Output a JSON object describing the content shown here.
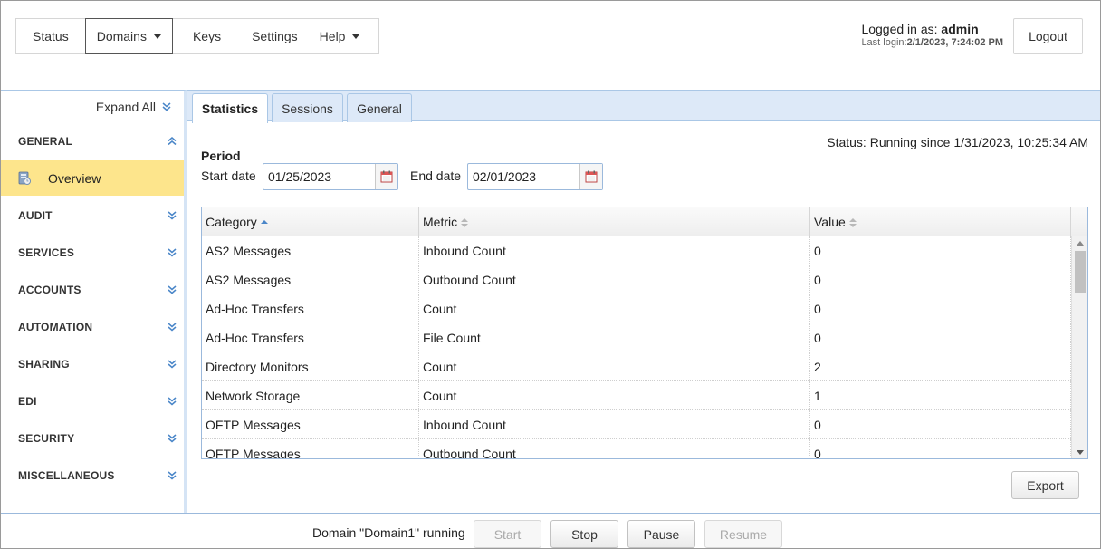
{
  "nav": {
    "items": [
      {
        "label": "Status"
      },
      {
        "label": "Domains"
      },
      {
        "label": "Keys"
      },
      {
        "label": "Settings"
      },
      {
        "label": "Help"
      }
    ]
  },
  "user": {
    "logged_in_prefix": "Logged in as:",
    "username": "admin",
    "last_login_prefix": "Last login:",
    "last_login": "2/1/2023, 7:24:02 PM",
    "logout_label": "Logout"
  },
  "sidebar": {
    "expand_all_label": "Expand All",
    "sections": [
      {
        "label": "GENERAL",
        "expanded": true
      },
      {
        "label": "AUDIT"
      },
      {
        "label": "SERVICES"
      },
      {
        "label": "ACCOUNTS"
      },
      {
        "label": "AUTOMATION"
      },
      {
        "label": "SHARING"
      },
      {
        "label": "EDI"
      },
      {
        "label": "SECURITY"
      },
      {
        "label": "MISCELLANEOUS"
      }
    ],
    "selected_item": {
      "label": "Overview",
      "icon": "overview-icon"
    }
  },
  "tabs": [
    {
      "label": "Statistics",
      "active": true
    },
    {
      "label": "Sessions"
    },
    {
      "label": "General"
    }
  ],
  "statistics": {
    "status_text": "Status: Running since 1/31/2023, 10:25:34 AM",
    "period_label": "Period",
    "start_date_label": "Start date",
    "start_date": "01/25/2023",
    "end_date_label": "End date",
    "end_date": "02/01/2023",
    "columns": [
      "Category",
      "Metric",
      "Value"
    ],
    "rows": [
      [
        "AS2 Messages",
        "Inbound Count",
        "0"
      ],
      [
        "AS2 Messages",
        "Outbound Count",
        "0"
      ],
      [
        "Ad-Hoc Transfers",
        "Count",
        "0"
      ],
      [
        "Ad-Hoc Transfers",
        "File Count",
        "0"
      ],
      [
        "Directory Monitors",
        "Count",
        "2"
      ],
      [
        "Network Storage",
        "Count",
        "1"
      ],
      [
        "OFTP Messages",
        "Inbound Count",
        "0"
      ],
      [
        "OFTP Messages",
        "Outbound Count",
        "0"
      ]
    ],
    "export_label": "Export"
  },
  "footer": {
    "domain_status": "Domain \"Domain1\" running",
    "buttons": [
      {
        "label": "Start",
        "enabled": false
      },
      {
        "label": "Stop",
        "enabled": true
      },
      {
        "label": "Pause",
        "enabled": true
      },
      {
        "label": "Resume",
        "enabled": false
      }
    ]
  },
  "colors": {
    "selected_item_bg": "#fde58c",
    "tabbar_bg": "#dde9f8",
    "border_blue": "#9bb9dc",
    "chevron_blue": "#4a86c8"
  }
}
